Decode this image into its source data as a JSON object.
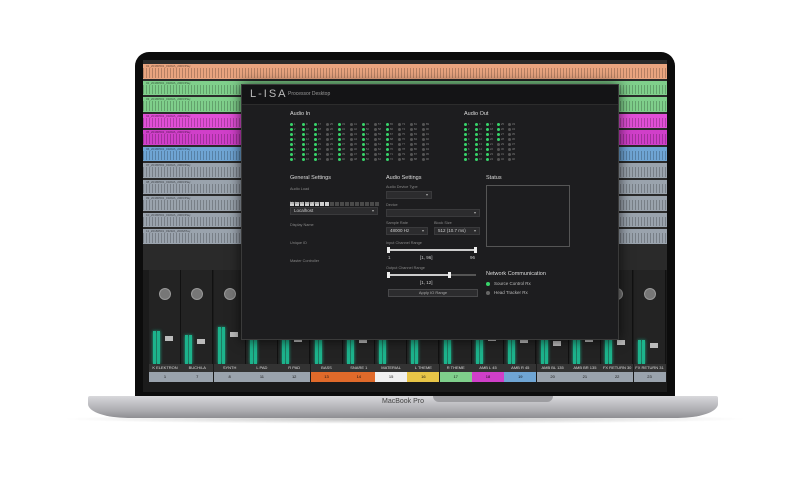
{
  "device": {
    "model": "MacBook Pro"
  },
  "daw": {
    "track_colors": [
      "#e9a47f",
      "#7fcf8b",
      "#7fcf8b",
      "#e04fd6",
      "#d03fc9",
      "#6fa5d4",
      "#9aa3ad",
      "#9aa3ad",
      "#9aa3ad",
      "#9aa3ad",
      "#9aa3ad"
    ],
    "track_labels": [
      "01_20180501_0329/A_2006/Play",
      "02_20180501_0329/A_2006/Play",
      "03_20180501_0329/A_2006/Play",
      "04_20180501_0329/A_2006/Play",
      "05_20180501_0329/A_2006/Play",
      "06_20180501_0329/A_2006/Play",
      "07_20180501_0329/A_2006/Play",
      "08_20180501_0329/A_2006/Play",
      "09_20180501_0329/A_2006/Play",
      "10_20180501_0329/A_2006/Play",
      "11_20180501_0329/A_2006/Play"
    ],
    "strips": [
      {
        "name": "K ELEKTRON",
        "num": "1",
        "color": "#9aa3ad",
        "level": 0.55
      },
      {
        "name": "BUCH/LA",
        "num": "7",
        "color": "#9aa3ad",
        "level": 0.48
      },
      {
        "name": "SYNTH",
        "num": "8",
        "color": "#9aa3ad",
        "level": 0.62
      },
      {
        "name": "L PAD",
        "num": "11",
        "color": "#9aa3ad",
        "level": 0.58
      },
      {
        "name": "R PAD",
        "num": "12",
        "color": "#9aa3ad",
        "level": 0.52
      },
      {
        "name": "BASS",
        "num": "13",
        "color": "#e06a2a",
        "level": 0.6
      },
      {
        "name": "SNARE 1",
        "num": "14",
        "color": "#e06a2a",
        "level": 0.5
      },
      {
        "name": "MATERIAL",
        "num": "15",
        "color": "#f0f0f0",
        "level": 0.7
      },
      {
        "name": "L THEME",
        "num": "16",
        "color": "#e8c547",
        "level": 0.62
      },
      {
        "name": "R THEME",
        "num": "17",
        "color": "#7fcf8b",
        "level": 0.58
      },
      {
        "name": "AMB L 45",
        "num": "18",
        "color": "#d03fc9",
        "level": 0.55
      },
      {
        "name": "AMB R 45",
        "num": "19",
        "color": "#6fa5d4",
        "level": 0.5
      },
      {
        "name": "AMB BL 135",
        "num": "20",
        "color": "#9aa3ad",
        "level": 0.44
      },
      {
        "name": "AMB BR 135",
        "num": "21",
        "color": "#9aa3ad",
        "level": 0.52
      },
      {
        "name": "FX RETURN 30",
        "num": "22",
        "color": "#9aa3ad",
        "level": 0.46
      },
      {
        "name": "FX RETURN 31",
        "num": "23",
        "color": "#9aa3ad",
        "level": 0.4
      }
    ]
  },
  "window": {
    "logo": "L-ISA",
    "title": "Processor Desktop",
    "audio_in": {
      "heading": "Audio In",
      "on": [
        1,
        2,
        3,
        4,
        5,
        6,
        7,
        8,
        9,
        10,
        11,
        12,
        13,
        14,
        15,
        16,
        17,
        18,
        19,
        20,
        21,
        22,
        23,
        24,
        33,
        34,
        35,
        36,
        37,
        38,
        39,
        40,
        49,
        50,
        51,
        52,
        53,
        54,
        55,
        56,
        65,
        66,
        67,
        68,
        69,
        70,
        71,
        72
      ]
    },
    "audio_out": {
      "heading": "Audio Out",
      "on": [
        1,
        2,
        3,
        4,
        5,
        6,
        7,
        8,
        9,
        10,
        11,
        12,
        13,
        14,
        15,
        16,
        17,
        18,
        19,
        20,
        21,
        22,
        23,
        24,
        25,
        26,
        27,
        28
      ]
    },
    "general": {
      "heading": "General Settings",
      "audio_load_label": "Audio Load",
      "audio_load_fraction": 0.45,
      "network_interface_label": "Network Interface",
      "network_interface_value": "Localhost",
      "display_name_label": "Display Name",
      "unique_id_label": "Unique ID",
      "master_controller_label": "Master Controller"
    },
    "audio": {
      "heading": "Audio Settings",
      "device_type_label": "Audio Device Type",
      "device_label": "Device",
      "sample_rate_label": "Sample Rate",
      "sample_rate_value": "48000 Hz",
      "block_size_label": "Block Size",
      "block_size_value": "512 (10.7 ms)",
      "input_range_label": "Input Channel Range",
      "input_range_min": "1",
      "input_range_text": "[1, 96]",
      "input_range_max": "96",
      "input_range_fraction": 1.0,
      "output_range_label": "Output Channel Range",
      "output_range_text": "[1, 12]",
      "output_range_fraction": 0.7,
      "apply_button": "Apply IO Range"
    },
    "status": {
      "heading": "Status"
    },
    "network": {
      "heading": "Network Communication",
      "items": [
        {
          "label": "Source Control Rx",
          "active": true
        },
        {
          "label": "Head Tracker Rx",
          "active": false
        }
      ]
    }
  },
  "colors": {
    "accent_green": "#38d46a",
    "meter_green": "#1db38c"
  }
}
